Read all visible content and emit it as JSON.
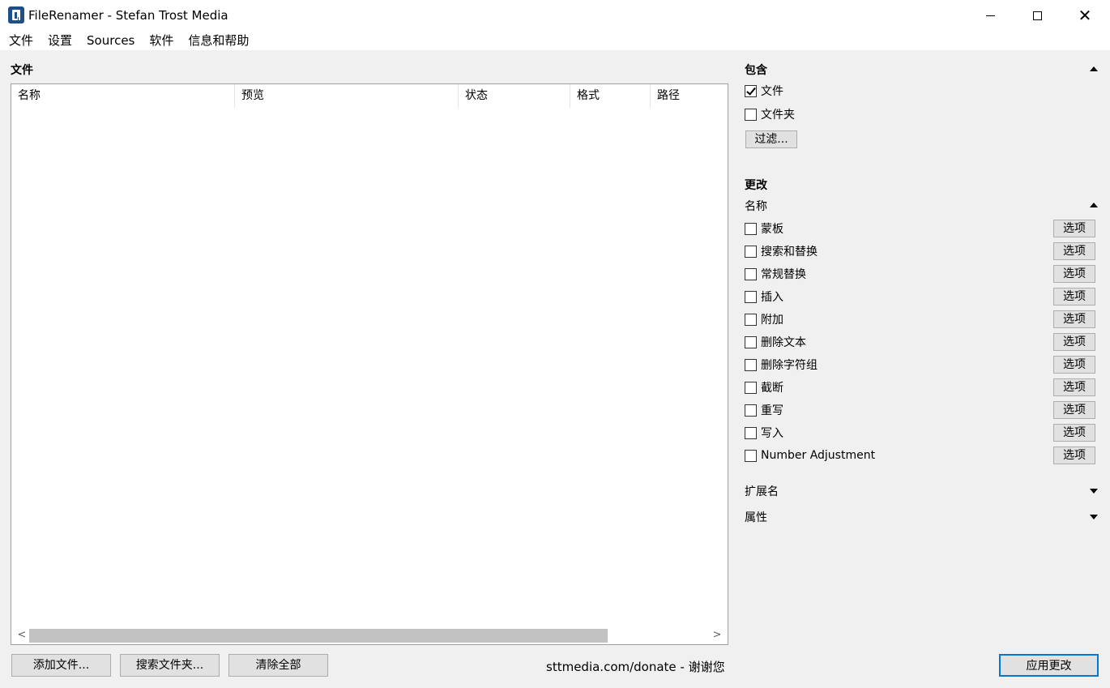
{
  "window": {
    "title": "FileRenamer - Stefan Trost Media",
    "minimize": "",
    "maximize": "",
    "close": "✕"
  },
  "menu": [
    "文件",
    "设置",
    "Sources",
    "软件",
    "信息和帮助"
  ],
  "files": {
    "title": "文件",
    "columns": [
      "名称",
      "预览",
      "状态",
      "格式",
      "路径"
    ],
    "rows": []
  },
  "scroll": {
    "left": "<",
    "right": ">"
  },
  "buttons": {
    "add_files": "添加文件...",
    "search_folder": "搜索文件夹...",
    "clear_all": "清除全部",
    "apply": "应用更改"
  },
  "donate": "sttmedia.com/donate - 谢谢您",
  "include": {
    "title": "包含",
    "files_label": "文件",
    "files_checked": true,
    "folders_label": "文件夹",
    "folders_checked": false,
    "filter_button": "过滤..."
  },
  "change": {
    "title": "更改",
    "name_section": "名称",
    "option_label": "选项",
    "options": [
      {
        "label": "蒙板",
        "checked": false
      },
      {
        "label": "搜索和替换",
        "checked": false
      },
      {
        "label": "常规替换",
        "checked": false
      },
      {
        "label": "插入",
        "checked": false
      },
      {
        "label": "附加",
        "checked": false
      },
      {
        "label": "删除文本",
        "checked": false
      },
      {
        "label": "删除字符组",
        "checked": false
      },
      {
        "label": "截断",
        "checked": false
      },
      {
        "label": "重写",
        "checked": false
      },
      {
        "label": "写入",
        "checked": false
      },
      {
        "label": "Number Adjustment",
        "checked": false
      }
    ],
    "extension_section": "扩展名",
    "attributes_section": "属性"
  }
}
